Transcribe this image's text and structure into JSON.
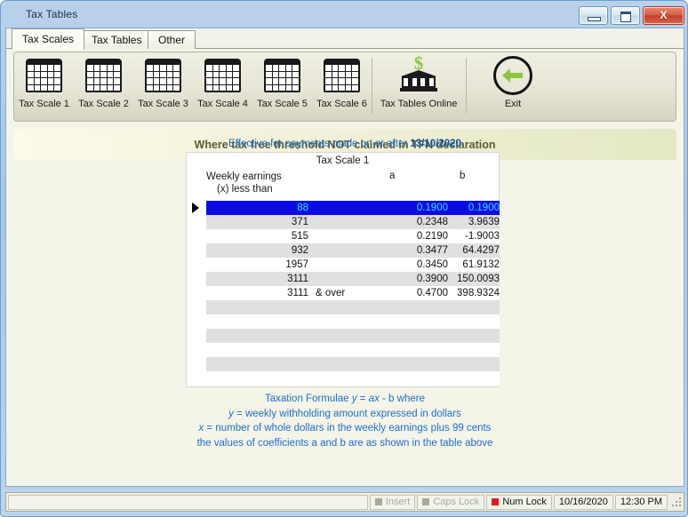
{
  "window": {
    "title": "Tax Tables",
    "buttons": {
      "minimize": "minimize",
      "maximize": "maximize",
      "close": "X"
    }
  },
  "tabs": [
    {
      "label": "Tax Scales",
      "active": true
    },
    {
      "label": "Tax Tables",
      "active": false
    },
    {
      "label": "Other",
      "active": false
    }
  ],
  "toolbar": {
    "items": [
      {
        "label": "Tax Scale 1",
        "icon": "table-grid-icon"
      },
      {
        "label": "Tax Scale 2",
        "icon": "table-grid-icon"
      },
      {
        "label": "Tax Scale 3",
        "icon": "table-grid-icon"
      },
      {
        "label": "Tax Scale 4",
        "icon": "table-grid-icon"
      },
      {
        "label": "Tax Scale 5",
        "icon": "table-grid-icon"
      },
      {
        "label": "Tax Scale 6",
        "icon": "table-grid-icon"
      },
      {
        "label": "Tax Tables Online",
        "icon": "bank-dollar-icon"
      },
      {
        "label": "Exit",
        "icon": "back-arrow-icon"
      }
    ]
  },
  "banner": {
    "heading": "Where tax free threshold NOT claimed in TFN declaration",
    "effective_prefix": "Effective for payments made on or after ",
    "effective_date": "13/10/2020",
    "colors": {
      "heading_text": "#5c5c33",
      "gradient_from": "#fcfbe8",
      "gradient_to": "#e4e8c3",
      "link_blue": "#1f6fc4"
    }
  },
  "table": {
    "title": "Tax Scale 1",
    "headers": {
      "x_line1": "Weekly earnings",
      "x_line2": "(x) less than",
      "a": "a",
      "b": "b"
    },
    "selected_row_index": 0,
    "rows": [
      {
        "x": "88",
        "over": "",
        "a": "0.1900",
        "b": "0.1900"
      },
      {
        "x": "371",
        "over": "",
        "a": "0.2348",
        "b": "3.9639"
      },
      {
        "x": "515",
        "over": "",
        "a": "0.2190",
        "b": "-1.9003"
      },
      {
        "x": "932",
        "over": "",
        "a": "0.3477",
        "b": "64.4297"
      },
      {
        "x": "1957",
        "over": "",
        "a": "0.3450",
        "b": "61.9132"
      },
      {
        "x": "3111",
        "over": "",
        "a": "0.3900",
        "b": "150.0093"
      },
      {
        "x": "3111",
        "over": "& over",
        "a": "0.4700",
        "b": "398.9324"
      },
      {
        "x": "",
        "over": "",
        "a": "",
        "b": ""
      },
      {
        "x": "",
        "over": "",
        "a": "",
        "b": ""
      },
      {
        "x": "",
        "over": "",
        "a": "",
        "b": ""
      },
      {
        "x": "",
        "over": "",
        "a": "",
        "b": ""
      },
      {
        "x": "",
        "over": "",
        "a": "",
        "b": ""
      },
      {
        "x": "",
        "over": "",
        "a": "",
        "b": ""
      }
    ],
    "colors": {
      "selected_bg": "#0a0ae8",
      "selected_text": "#33e0ff",
      "alt_row_bg": "#e0e0e0"
    }
  },
  "formula": {
    "line1_pre": "Taxation Formulae ",
    "line1_var_y": "y",
    "line1_mid": " = ",
    "line1_var_a": "a",
    "line1_var_x": "x",
    "line1_post": " - b where",
    "line2_var": "y",
    "line2_text": " = weekly withholding amount expressed in dollars",
    "line3_var": "x",
    "line3_text": " = number of whole dollars in the weekly earnings plus 99 cents",
    "line4": "the values of coefficients a and b are as shown in the table above"
  },
  "statusbar": {
    "message": "",
    "insert": "Insert",
    "caps_lock": "Caps Lock",
    "num_lock": "Num Lock",
    "date": "10/16/2020",
    "time": "12:30 PM"
  }
}
